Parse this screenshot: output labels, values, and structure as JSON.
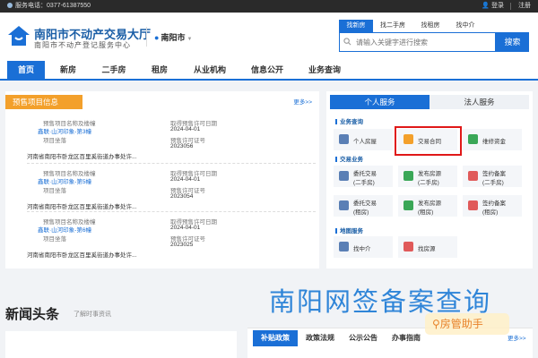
{
  "topbar": {
    "hotline": "服务电话：0377-61387550",
    "login": "登录",
    "register": "注册"
  },
  "header": {
    "title": "南阳市不动产交易大厅",
    "subtitle": "南阳市不动产登记服务中心",
    "city": "南阳市",
    "search_tabs": [
      "找新房",
      "找二手房",
      "找租房",
      "找中介"
    ],
    "search_placeholder": "请输入关键字进行搜索",
    "search_button": "搜索"
  },
  "nav": [
    "首页",
    "新房",
    "二手房",
    "租房",
    "从业机构",
    "信息公开",
    "业务查询"
  ],
  "presale": {
    "title": "预售项目信息",
    "more": "更多>>",
    "items": [
      {
        "name_label": "预售项目名称及楼幢",
        "name": "鑫联·山河印象-第3幢",
        "date_label": "取得预售许可日期",
        "date": "2024-04-01",
        "loc_label": "项目坐落",
        "permit_label": "预售许可证号",
        "permit": "2023056",
        "address": "河南省南阳市卧龙区百里奚街道办事处许..."
      },
      {
        "name_label": "预售项目名称及楼幢",
        "name": "鑫联·山河印象-第5幢",
        "date_label": "取得预售许可日期",
        "date": "2024-04-01",
        "loc_label": "项目坐落",
        "permit_label": "预售许可证号",
        "permit": "2023054",
        "address": "河南省南阳市卧龙区百里奚街道办事处许..."
      },
      {
        "name_label": "预售项目名称及楼幢",
        "name": "鑫联·山河印象-第6幢",
        "date_label": "取得预售许可日期",
        "date": "2024-04-01",
        "loc_label": "项目坐落",
        "permit_label": "预售许可证号",
        "permit": "2023025",
        "address": "河南省南阳市卧龙区百里奚街道办事处许..."
      }
    ]
  },
  "services": {
    "tabs": [
      "个人服务",
      "法人服务"
    ],
    "sections": [
      "业务查询",
      "交易业务",
      "地图服务"
    ],
    "query": [
      "个人房屋",
      "交易合同",
      "维修资金"
    ],
    "trade": [
      {
        "l1": "委托交易",
        "l2": "(二手房)"
      },
      {
        "l1": "发布房源",
        "l2": "(二手房)"
      },
      {
        "l1": "签约备案",
        "l2": "(二手房)"
      },
      {
        "l1": "委托交易",
        "l2": "(租房)"
      },
      {
        "l1": "发布房源",
        "l2": "(租房)"
      },
      {
        "l1": "签约备案",
        "l2": "(租房)"
      }
    ],
    "map": [
      "找中介",
      "找房源"
    ]
  },
  "news": {
    "title": "新闻头条",
    "subtitle": "了解时事资讯",
    "tabs": [
      "补贴政策",
      "政策法规",
      "公示公告",
      "办事指南"
    ],
    "more": "更多>>"
  },
  "watermark": {
    "title": "南阳网签备案查询",
    "badge": "房管助手"
  },
  "colors": {
    "primary": "#1a6fd6",
    "accent": "#f3a02b",
    "highlight": "#e01818"
  }
}
